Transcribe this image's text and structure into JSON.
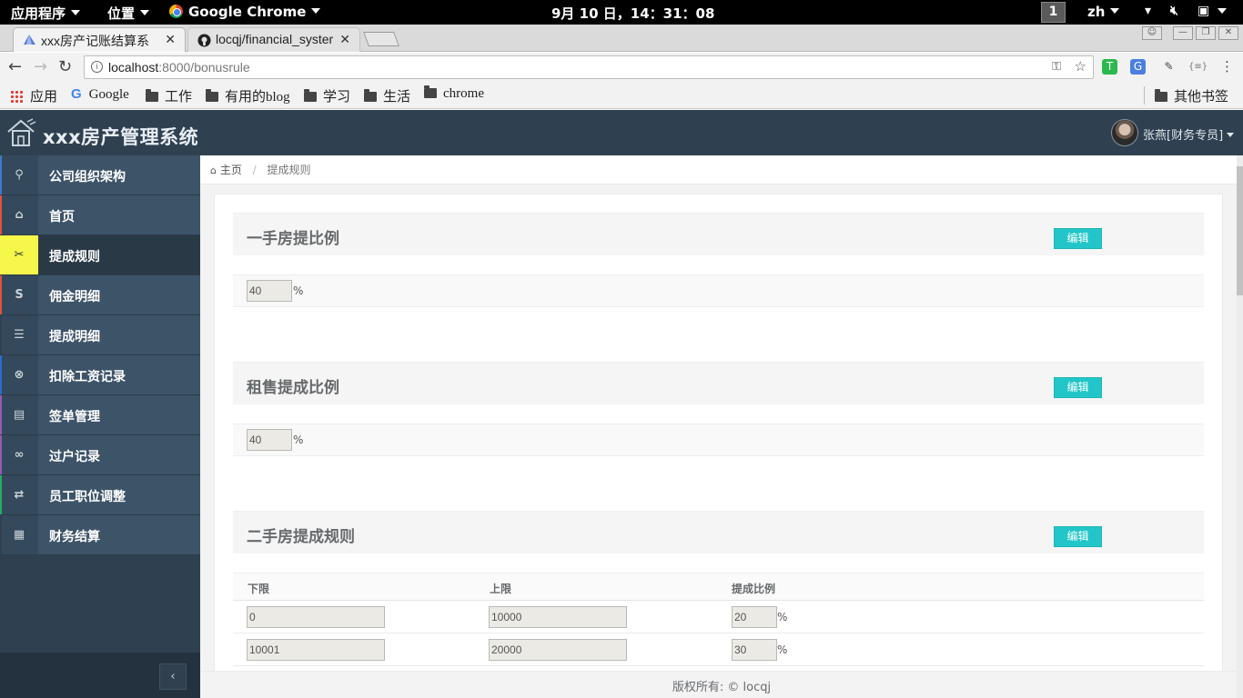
{
  "system_bar": {
    "apps_menu": "应用程序",
    "places_menu": "位置",
    "browser_menu": "Google Chrome",
    "clock": "9月 10 日，14：31：08",
    "workspace": "1",
    "input_method": "zh"
  },
  "tabs": [
    {
      "title": "xxx房产记账结算系"
    },
    {
      "title": "locqj/financial_syster"
    }
  ],
  "address_bar": {
    "host": "localhost",
    "path": ":8000/bonusrule"
  },
  "bookmarks": [
    {
      "label": "应用",
      "icon": "apps-grid-icon"
    },
    {
      "label": "Google",
      "icon": "google-icon"
    },
    {
      "label": "工作",
      "icon": "folder-icon"
    },
    {
      "label": "有用的blog",
      "icon": "folder-icon"
    },
    {
      "label": "学习",
      "icon": "folder-icon"
    },
    {
      "label": "生活",
      "icon": "folder-icon"
    },
    {
      "label": "chrome",
      "icon": "folder-icon"
    }
  ],
  "other_bookmarks": "其他书签",
  "app": {
    "title": "xxx房产管理系统",
    "user": "张燕[财务专员]"
  },
  "sidebar": {
    "items": [
      {
        "label": "公司组织架构",
        "icon": "sitemap-icon",
        "glyph": "⚲",
        "stripe": "#3a7bd5"
      },
      {
        "label": "首页",
        "icon": "home-icon",
        "glyph": "⌂",
        "stripe": "#e0533e"
      },
      {
        "label": "提成规则",
        "icon": "tools-icon",
        "glyph": "✂",
        "stripe": "#f5f84a"
      },
      {
        "label": "佣金明细",
        "icon": "strikethrough-icon",
        "glyph": "S",
        "stripe": "#e0533e"
      },
      {
        "label": "提成明细",
        "icon": "list-icon",
        "glyph": "☰",
        "stripe": "#2f4050"
      },
      {
        "label": "扣除工资记录",
        "icon": "times-circle-icon",
        "glyph": "⊗",
        "stripe": "#2a6cd6"
      },
      {
        "label": "签单管理",
        "icon": "list-alt-icon",
        "glyph": "▤",
        "stripe": "#9b59b6"
      },
      {
        "label": "过户记录",
        "icon": "link-icon",
        "glyph": "∞",
        "stripe": "#9b59b6"
      },
      {
        "label": "员工职位调整",
        "icon": "exchange-icon",
        "glyph": "⇄",
        "stripe": "#27ae60"
      },
      {
        "label": "财务结算",
        "icon": "table-icon",
        "glyph": "▦",
        "stripe": "#2f4050"
      }
    ],
    "active_index": 2
  },
  "breadcrumb": {
    "home": "主页",
    "current": "提成规则"
  },
  "sections": {
    "new_house": {
      "title": "一手房提比例",
      "edit": "编辑",
      "value": "40",
      "unit": "%"
    },
    "rental": {
      "title": "租售提成比例",
      "edit": "编辑",
      "value": "40",
      "unit": "%"
    },
    "second_hand": {
      "title": "二手房提成规则",
      "edit": "编辑",
      "columns": [
        "下限",
        "上限",
        "提成比例"
      ],
      "rows": [
        {
          "lower": "0",
          "upper": "10000",
          "rate": "20",
          "unit": "%"
        },
        {
          "lower": "10001",
          "upper": "20000",
          "rate": "30",
          "unit": "%"
        }
      ]
    }
  },
  "footer": "版权所有: © locqj"
}
